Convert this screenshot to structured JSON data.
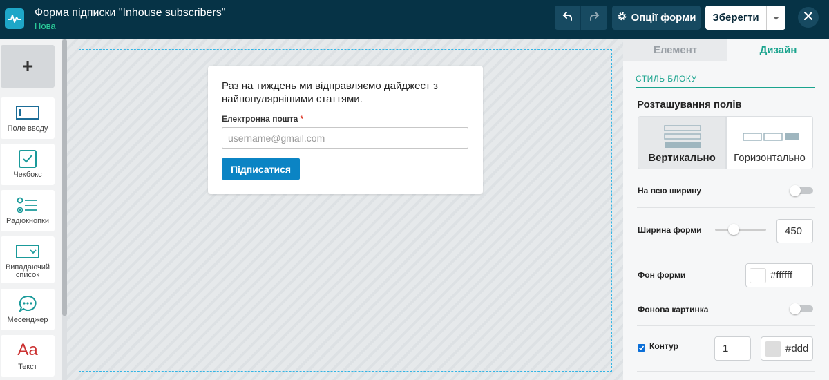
{
  "header": {
    "title": "Форма підписки \"Inhouse subscribers\"",
    "status": "Нова",
    "options_label": "Опції форми",
    "save_label": "Зберегти",
    "icons": [
      "pulse-logo-icon",
      "undo-icon",
      "redo-icon",
      "gear-icon",
      "chevron-down-icon",
      "close-icon"
    ]
  },
  "toolbox": {
    "add_label": "+",
    "items": [
      {
        "label": "Поле вводу",
        "icon": "text-field-icon"
      },
      {
        "label": "Чекбокс",
        "icon": "checkbox-icon"
      },
      {
        "label": "Радіокнопки",
        "icon": "radio-buttons-icon"
      },
      {
        "label": "Випадаючий список",
        "icon": "dropdown-icon"
      },
      {
        "label": "Месенджер",
        "icon": "messenger-icon"
      },
      {
        "label": "Текст",
        "icon": "text-icon",
        "glyph": "Aa"
      }
    ]
  },
  "form": {
    "description": "Раз на тиждень ми відправляємо дайджест з найпопулярнішими статтями.",
    "email_label": "Електронна пошта",
    "required_mark": "*",
    "email_placeholder": "username@gmail.com",
    "submit_label": "Підписатися"
  },
  "panel": {
    "tabs": {
      "element": "Елемент",
      "design": "Дизайн",
      "active": "design"
    },
    "section_title": "СТИЛЬ БЛОКУ",
    "fields_layout": {
      "title": "Розташування полів",
      "vertical": "Вертикально",
      "horizontal": "Горизонтально",
      "selected": "vertical"
    },
    "full_width": {
      "label": "На всю ширину",
      "on": false
    },
    "form_width": {
      "label": "Ширина форми",
      "value": "450"
    },
    "form_bg": {
      "label": "Фон форми",
      "value": "#ffffff",
      "swatch": "#ffffff"
    },
    "bg_image": {
      "label": "Фонова картинка",
      "on": false
    },
    "outline": {
      "label": "Контур",
      "checked": true,
      "width": "1",
      "color": "#ddd",
      "swatch": "#dddddd"
    }
  },
  "colors": {
    "topbar": "#063346",
    "accent_green": "#1aa48e",
    "submit_blue": "#0b84c4"
  }
}
